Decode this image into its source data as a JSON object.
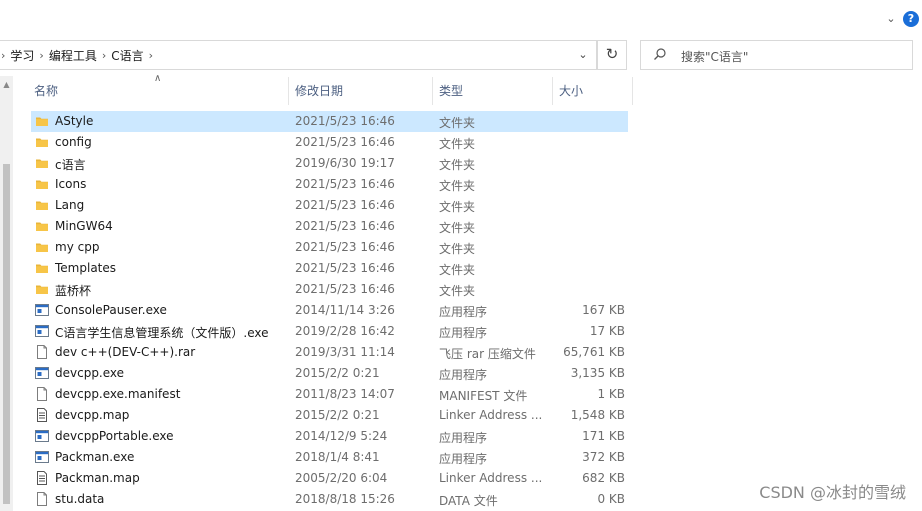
{
  "breadcrumbs": [
    "学习",
    "编程工具",
    "C语言"
  ],
  "search": {
    "placeholder": "搜索\"C语言\""
  },
  "columns": {
    "name": "名称",
    "date": "修改日期",
    "type": "类型",
    "size": "大小"
  },
  "files": [
    {
      "name": "AStyle",
      "date": "2021/5/23 16:46",
      "type": "文件夹",
      "size": "",
      "icon": "folder-icon",
      "selected": true
    },
    {
      "name": "config",
      "date": "2021/5/23 16:46",
      "type": "文件夹",
      "size": "",
      "icon": "folder-icon"
    },
    {
      "name": "c语言",
      "date": "2019/6/30 19:17",
      "type": "文件夹",
      "size": "",
      "icon": "folder-icon"
    },
    {
      "name": "Icons",
      "date": "2021/5/23 16:46",
      "type": "文件夹",
      "size": "",
      "icon": "folder-icon"
    },
    {
      "name": "Lang",
      "date": "2021/5/23 16:46",
      "type": "文件夹",
      "size": "",
      "icon": "folder-icon"
    },
    {
      "name": "MinGW64",
      "date": "2021/5/23 16:46",
      "type": "文件夹",
      "size": "",
      "icon": "folder-icon"
    },
    {
      "name": "my cpp",
      "date": "2021/5/23 16:46",
      "type": "文件夹",
      "size": "",
      "icon": "folder-icon"
    },
    {
      "name": "Templates",
      "date": "2021/5/23 16:46",
      "type": "文件夹",
      "size": "",
      "icon": "folder-icon"
    },
    {
      "name": "蓝桥杯",
      "date": "2021/5/23 16:46",
      "type": "文件夹",
      "size": "",
      "icon": "folder-icon"
    },
    {
      "name": "ConsolePauser.exe",
      "date": "2014/11/14 3:26",
      "type": "应用程序",
      "size": "167 KB",
      "icon": "exe-icon"
    },
    {
      "name": "C语言学生信息管理系统（文件版）.exe",
      "date": "2019/2/28 16:42",
      "type": "应用程序",
      "size": "17 KB",
      "icon": "exe-icon"
    },
    {
      "name": "dev c++(DEV-C++).rar",
      "date": "2019/3/31 11:14",
      "type": "飞压 rar 压缩文件",
      "size": "65,761 KB",
      "icon": "file-icon"
    },
    {
      "name": "devcpp.exe",
      "date": "2015/2/2 0:21",
      "type": "应用程序",
      "size": "3,135 KB",
      "icon": "exe-icon"
    },
    {
      "name": "devcpp.exe.manifest",
      "date": "2011/8/23 14:07",
      "type": "MANIFEST 文件",
      "size": "1 KB",
      "icon": "file-icon"
    },
    {
      "name": "devcpp.map",
      "date": "2015/2/2 0:21",
      "type": "Linker Address ...",
      "size": "1,548 KB",
      "icon": "text-file-icon"
    },
    {
      "name": "devcppPortable.exe",
      "date": "2014/12/9 5:24",
      "type": "应用程序",
      "size": "171 KB",
      "icon": "exe-icon"
    },
    {
      "name": "Packman.exe",
      "date": "2018/1/4 8:41",
      "type": "应用程序",
      "size": "372 KB",
      "icon": "exe-icon"
    },
    {
      "name": "Packman.map",
      "date": "2005/2/20 6:04",
      "type": "Linker Address ...",
      "size": "682 KB",
      "icon": "text-file-icon"
    },
    {
      "name": "stu.data",
      "date": "2018/8/18 15:26",
      "type": "DATA 文件",
      "size": "0 KB",
      "icon": "file-icon"
    }
  ],
  "watermark": "CSDN @冰封的雪绒",
  "colors": {
    "selection": "#cce8ff",
    "folder": "#f7c548",
    "exe_blue": "#2b6cc4",
    "header_text": "#4d6082"
  }
}
